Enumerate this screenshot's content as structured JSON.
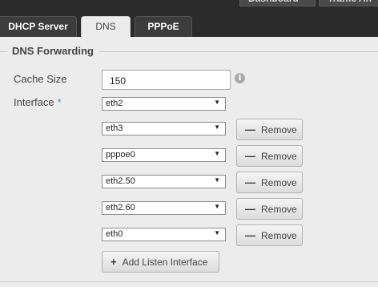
{
  "top_nav": {
    "dashboard": "Dashboard",
    "traffic": "Traffic An"
  },
  "tabs": [
    {
      "label": "DHCP Server"
    },
    {
      "label": "DNS"
    },
    {
      "label": "PPPoE"
    }
  ],
  "section": {
    "legend": "DNS Forwarding",
    "cache_size_label": "Cache Size",
    "cache_size_value": "150",
    "interface_label": "Interface",
    "required_mark": "*",
    "info_icon_glyph": "i"
  },
  "interfaces": [
    {
      "value": "eth2"
    },
    {
      "value": "eth3",
      "remove_label": "Remove"
    },
    {
      "value": "pppoe0",
      "remove_label": "Remove"
    },
    {
      "value": "eth2.50",
      "remove_label": "Remove"
    },
    {
      "value": "eth2.60",
      "remove_label": "Remove"
    },
    {
      "value": "eth0",
      "remove_label": "Remove"
    }
  ],
  "add_button_label": "Add Listen Interface",
  "icons": {
    "remove": "minus-icon",
    "add": "plus-icon",
    "info": "info-icon",
    "select_arrow": "triangle-down-icon"
  },
  "colors": {
    "background": "#ececec",
    "topbar": "#2b2b2b",
    "required": "#3a8edb"
  }
}
